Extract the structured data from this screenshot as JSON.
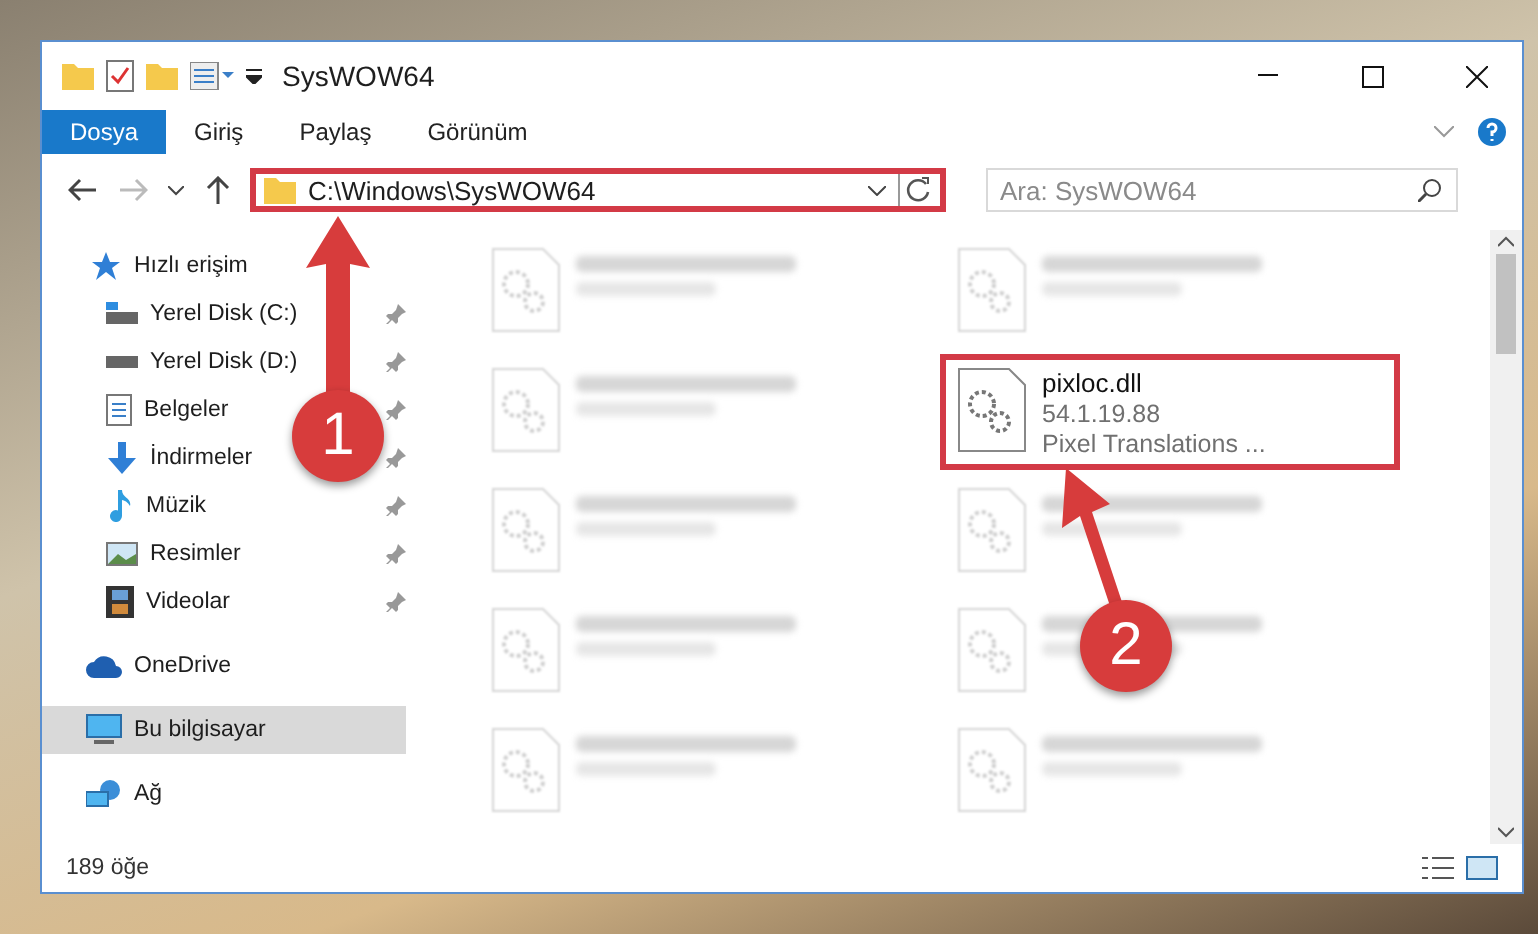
{
  "window": {
    "title": "SysWOW64"
  },
  "ribbon_tabs": [
    {
      "label": "Dosya",
      "selected": true
    },
    {
      "label": "Giriş",
      "selected": false
    },
    {
      "label": "Paylaş",
      "selected": false
    },
    {
      "label": "Görünüm",
      "selected": false
    }
  ],
  "address_bar": {
    "value": "C:\\Windows\\SysWOW64",
    "highlighted": true
  },
  "search": {
    "placeholder": "Ara: SysWOW64"
  },
  "navigation": [
    {
      "label": "Hızlı erişim",
      "selected": false,
      "children": [
        {
          "label": "Yerel Disk (C:)",
          "selected": false,
          "pinned": true
        },
        {
          "label": "Yerel Disk (D:)",
          "selected": false,
          "pinned": true
        },
        {
          "label": "Belgeler",
          "selected": false,
          "pinned": true
        },
        {
          "label": "İndirmeler",
          "selected": false,
          "pinned": true
        },
        {
          "label": "Müzik",
          "selected": false,
          "pinned": true
        },
        {
          "label": "Resimler",
          "selected": false,
          "pinned": true
        },
        {
          "label": "Videolar",
          "selected": false,
          "pinned": true
        }
      ]
    },
    {
      "label": "OneDrive",
      "selected": false
    },
    {
      "label": "Bu bilgisayar",
      "selected": true
    },
    {
      "label": "Ağ",
      "selected": false
    }
  ],
  "files": [
    {
      "blurred": true,
      "highlighted": false
    },
    {
      "blurred": true,
      "highlighted": false
    },
    {
      "blurred": true,
      "highlighted": false
    },
    {
      "name": "pixloc.dll",
      "details": [
        "54.1.19.88",
        "Pixel Translations ..."
      ],
      "blurred": false,
      "highlighted": true
    },
    {
      "blurred": true,
      "highlighted": false
    },
    {
      "blurred": true,
      "highlighted": false
    },
    {
      "blurred": true,
      "highlighted": false
    },
    {
      "blurred": true,
      "highlighted": false
    },
    {
      "blurred": true,
      "highlighted": false
    },
    {
      "blurred": true,
      "highlighted": false
    }
  ],
  "status_bar": {
    "item_count": "189 öğe"
  },
  "annotations": [
    {
      "label": "1"
    },
    {
      "label": "2"
    }
  ]
}
